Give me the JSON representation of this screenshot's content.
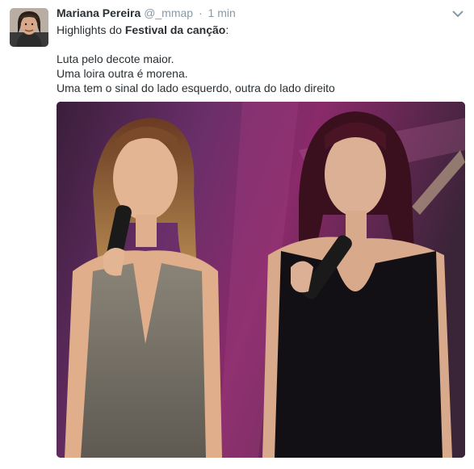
{
  "tweet": {
    "author": {
      "name": "Mariana Pereira",
      "handle": "@_mmap",
      "separator": "·",
      "time": "1 min"
    },
    "line1": {
      "prefix": "Highlights do ",
      "bold": "Festival da canção",
      "suffix": ":"
    },
    "lines": [
      "Luta pelo decote maior.",
      "Uma loira outra é morena.",
      "Uma tem o sinal do lado esquerdo, outra do lado direito"
    ],
    "icons": {
      "menu": "chevron-down-icon",
      "avatar": "avatar"
    },
    "colors": {
      "name": "#292f33",
      "meta": "#8899a6",
      "text": "#292f33"
    }
  }
}
